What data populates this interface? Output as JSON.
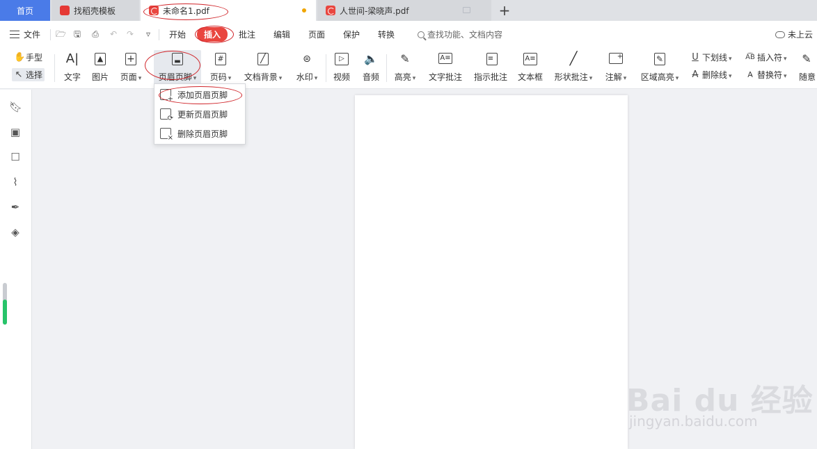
{
  "tabs": [
    {
      "label": "首页"
    },
    {
      "label": "找稻壳模板"
    },
    {
      "label": "未命名1.pdf"
    },
    {
      "label": "人世间-梁晓声.pdf"
    }
  ],
  "menu": {
    "file": "文件",
    "tabs": [
      "开始",
      "插入",
      "批注",
      "编辑",
      "页面",
      "保护",
      "转换"
    ],
    "active": "插入",
    "search_placeholder": "查找功能、文档内容",
    "cloud": "未上云"
  },
  "ribbon": {
    "hand": "手型",
    "select": "选择",
    "text": "文字",
    "image": "图片",
    "page": "页面",
    "header_footer": "页眉页脚",
    "page_number": "页码",
    "doc_background": "文档背景",
    "watermark": "水印",
    "video": "视频",
    "audio": "音频",
    "highlight": "高亮",
    "text_comment": "文字批注",
    "pointer_comment": "指示批注",
    "text_box": "文本框",
    "shape_comment": "形状批注",
    "note": "注解",
    "area_highlight": "区域高亮",
    "underline": "下划线",
    "strikethrough": "删除线",
    "insert_char": "插入符",
    "replace_char": "替换符",
    "random": "随意"
  },
  "dropdown": {
    "add": "添加页眉页脚",
    "update": "更新页眉页脚",
    "delete": "删除页眉页脚"
  },
  "watermark": {
    "big": "Bai du 经验",
    "small": "jingyan.baidu.com"
  },
  "colors": {
    "accent": "#e9463f",
    "home_tab": "#4a7be8",
    "annotation_oval": "#d0252a"
  }
}
